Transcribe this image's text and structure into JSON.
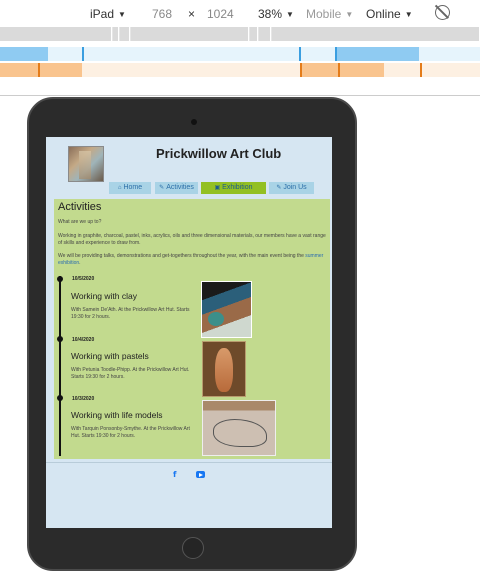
{
  "devtools": {
    "device": "iPad",
    "width": "768",
    "times": "×",
    "height": "1024",
    "zoom": "38%",
    "throttle": "Mobile",
    "network": "Online"
  },
  "site": {
    "title": "Prickwillow Art Club",
    "nav": [
      {
        "icon": "⌂",
        "label": "Home"
      },
      {
        "icon": "✎",
        "label": "Activities"
      },
      {
        "icon": "▣",
        "label": "Exhibition"
      },
      {
        "icon": "✎",
        "label": "Join Us"
      }
    ],
    "heading": "Activities",
    "para1": "What are we up to?",
    "para2": "Working in graphite, charcoal, pastel, inks, acrylics, oils and three dimensional materials, our members have a vast range of skills and experience to draw from.",
    "para3_before": "We will be providing talks, demonstrations and get-togethers throughout the year, with the main event being the ",
    "para3_link": "summer exhibition",
    "para3_after": ".",
    "events": [
      {
        "date": "10/5/2020",
        "title": "Working with clay",
        "desc": "With Samein De'Ath. At the Prickwillow Art Hut. Starts 19:30 for 2 hours."
      },
      {
        "date": "10/4/2020",
        "title": "Working with pastels",
        "desc": "With Petunia Toodle-Phipp. At the Prickwillow Art Hut. Starts 19:30 for 2 hours."
      },
      {
        "date": "10/3/2020",
        "title": "Working with life models",
        "desc": "With Tarquin Ponsonby-Smythe. At the Prickwillow Art Hut. Starts 19:30 for 2 hours."
      }
    ],
    "social": {
      "facebook": "f"
    }
  }
}
